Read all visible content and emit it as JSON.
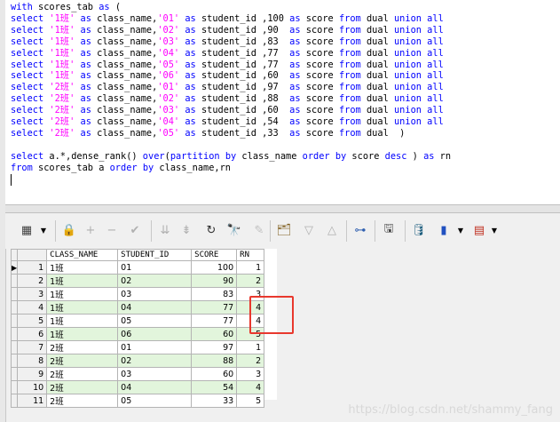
{
  "sql": {
    "lines": [
      [
        [
          "kw",
          "with"
        ],
        [
          "t",
          " scores_tab "
        ],
        [
          "kw",
          "as"
        ],
        [
          "t",
          " ("
        ]
      ],
      [
        [
          "kw",
          "select"
        ],
        [
          "t",
          " "
        ],
        [
          "str",
          "'1班'"
        ],
        [
          "t",
          " "
        ],
        [
          "kw",
          "as"
        ],
        [
          "t",
          " class_name,"
        ],
        [
          "str",
          "'01'"
        ],
        [
          "t",
          " "
        ],
        [
          "kw",
          "as"
        ],
        [
          "t",
          " student_id ,100 "
        ],
        [
          "kw",
          "as"
        ],
        [
          "t",
          " score "
        ],
        [
          "kw",
          "from"
        ],
        [
          "t",
          " dual "
        ],
        [
          "kw",
          "union"
        ],
        [
          "t",
          " "
        ],
        [
          "kw",
          "all"
        ]
      ],
      [
        [
          "kw",
          "select"
        ],
        [
          "t",
          " "
        ],
        [
          "str",
          "'1班'"
        ],
        [
          "t",
          " "
        ],
        [
          "kw",
          "as"
        ],
        [
          "t",
          " class_name,"
        ],
        [
          "str",
          "'02'"
        ],
        [
          "t",
          " "
        ],
        [
          "kw",
          "as"
        ],
        [
          "t",
          " student_id ,90  "
        ],
        [
          "kw",
          "as"
        ],
        [
          "t",
          " score "
        ],
        [
          "kw",
          "from"
        ],
        [
          "t",
          " dual "
        ],
        [
          "kw",
          "union"
        ],
        [
          "t",
          " "
        ],
        [
          "kw",
          "all"
        ]
      ],
      [
        [
          "kw",
          "select"
        ],
        [
          "t",
          " "
        ],
        [
          "str",
          "'1班'"
        ],
        [
          "t",
          " "
        ],
        [
          "kw",
          "as"
        ],
        [
          "t",
          " class_name,"
        ],
        [
          "str",
          "'03'"
        ],
        [
          "t",
          " "
        ],
        [
          "kw",
          "as"
        ],
        [
          "t",
          " student_id ,83  "
        ],
        [
          "kw",
          "as"
        ],
        [
          "t",
          " score "
        ],
        [
          "kw",
          "from"
        ],
        [
          "t",
          " dual "
        ],
        [
          "kw",
          "union"
        ],
        [
          "t",
          " "
        ],
        [
          "kw",
          "all"
        ]
      ],
      [
        [
          "kw",
          "select"
        ],
        [
          "t",
          " "
        ],
        [
          "str",
          "'1班'"
        ],
        [
          "t",
          " "
        ],
        [
          "kw",
          "as"
        ],
        [
          "t",
          " class_name,"
        ],
        [
          "str",
          "'04'"
        ],
        [
          "t",
          " "
        ],
        [
          "kw",
          "as"
        ],
        [
          "t",
          " student_id ,77  "
        ],
        [
          "kw",
          "as"
        ],
        [
          "t",
          " score "
        ],
        [
          "kw",
          "from"
        ],
        [
          "t",
          " dual "
        ],
        [
          "kw",
          "union"
        ],
        [
          "t",
          " "
        ],
        [
          "kw",
          "all"
        ]
      ],
      [
        [
          "kw",
          "select"
        ],
        [
          "t",
          " "
        ],
        [
          "str",
          "'1班'"
        ],
        [
          "t",
          " "
        ],
        [
          "kw",
          "as"
        ],
        [
          "t",
          " class_name,"
        ],
        [
          "str",
          "'05'"
        ],
        [
          "t",
          " "
        ],
        [
          "kw",
          "as"
        ],
        [
          "t",
          " student_id ,77  "
        ],
        [
          "kw",
          "as"
        ],
        [
          "t",
          " score "
        ],
        [
          "kw",
          "from"
        ],
        [
          "t",
          " dual "
        ],
        [
          "kw",
          "union"
        ],
        [
          "t",
          " "
        ],
        [
          "kw",
          "all"
        ]
      ],
      [
        [
          "kw",
          "select"
        ],
        [
          "t",
          " "
        ],
        [
          "str",
          "'1班'"
        ],
        [
          "t",
          " "
        ],
        [
          "kw",
          "as"
        ],
        [
          "t",
          " class_name,"
        ],
        [
          "str",
          "'06'"
        ],
        [
          "t",
          " "
        ],
        [
          "kw",
          "as"
        ],
        [
          "t",
          " student_id ,60  "
        ],
        [
          "kw",
          "as"
        ],
        [
          "t",
          " score "
        ],
        [
          "kw",
          "from"
        ],
        [
          "t",
          " dual "
        ],
        [
          "kw",
          "union"
        ],
        [
          "t",
          " "
        ],
        [
          "kw",
          "all"
        ]
      ],
      [
        [
          "kw",
          "select"
        ],
        [
          "t",
          " "
        ],
        [
          "str",
          "'2班'"
        ],
        [
          "t",
          " "
        ],
        [
          "kw",
          "as"
        ],
        [
          "t",
          " class_name,"
        ],
        [
          "str",
          "'01'"
        ],
        [
          "t",
          " "
        ],
        [
          "kw",
          "as"
        ],
        [
          "t",
          " student_id ,97  "
        ],
        [
          "kw",
          "as"
        ],
        [
          "t",
          " score "
        ],
        [
          "kw",
          "from"
        ],
        [
          "t",
          " dual "
        ],
        [
          "kw",
          "union"
        ],
        [
          "t",
          " "
        ],
        [
          "kw",
          "all"
        ]
      ],
      [
        [
          "kw",
          "select"
        ],
        [
          "t",
          " "
        ],
        [
          "str",
          "'2班'"
        ],
        [
          "t",
          " "
        ],
        [
          "kw",
          "as"
        ],
        [
          "t",
          " class_name,"
        ],
        [
          "str",
          "'02'"
        ],
        [
          "t",
          " "
        ],
        [
          "kw",
          "as"
        ],
        [
          "t",
          " student_id ,88  "
        ],
        [
          "kw",
          "as"
        ],
        [
          "t",
          " score "
        ],
        [
          "kw",
          "from"
        ],
        [
          "t",
          " dual "
        ],
        [
          "kw",
          "union"
        ],
        [
          "t",
          " "
        ],
        [
          "kw",
          "all"
        ]
      ],
      [
        [
          "kw",
          "select"
        ],
        [
          "t",
          " "
        ],
        [
          "str",
          "'2班'"
        ],
        [
          "t",
          " "
        ],
        [
          "kw",
          "as"
        ],
        [
          "t",
          " class_name,"
        ],
        [
          "str",
          "'03'"
        ],
        [
          "t",
          " "
        ],
        [
          "kw",
          "as"
        ],
        [
          "t",
          " student_id ,60  "
        ],
        [
          "kw",
          "as"
        ],
        [
          "t",
          " score "
        ],
        [
          "kw",
          "from"
        ],
        [
          "t",
          " dual "
        ],
        [
          "kw",
          "union"
        ],
        [
          "t",
          " "
        ],
        [
          "kw",
          "all"
        ]
      ],
      [
        [
          "kw",
          "select"
        ],
        [
          "t",
          " "
        ],
        [
          "str",
          "'2班'"
        ],
        [
          "t",
          " "
        ],
        [
          "kw",
          "as"
        ],
        [
          "t",
          " class_name,"
        ],
        [
          "str",
          "'04'"
        ],
        [
          "t",
          " "
        ],
        [
          "kw",
          "as"
        ],
        [
          "t",
          " student_id ,54  "
        ],
        [
          "kw",
          "as"
        ],
        [
          "t",
          " score "
        ],
        [
          "kw",
          "from"
        ],
        [
          "t",
          " dual "
        ],
        [
          "kw",
          "union"
        ],
        [
          "t",
          " "
        ],
        [
          "kw",
          "all"
        ]
      ],
      [
        [
          "kw",
          "select"
        ],
        [
          "t",
          " "
        ],
        [
          "str",
          "'2班'"
        ],
        [
          "t",
          " "
        ],
        [
          "kw",
          "as"
        ],
        [
          "t",
          " class_name,"
        ],
        [
          "str",
          "'05'"
        ],
        [
          "t",
          " "
        ],
        [
          "kw",
          "as"
        ],
        [
          "t",
          " student_id ,33  "
        ],
        [
          "kw",
          "as"
        ],
        [
          "t",
          " score "
        ],
        [
          "kw",
          "from"
        ],
        [
          "t",
          " dual  )"
        ]
      ],
      [],
      [
        [
          "kw",
          "select"
        ],
        [
          "t",
          " a.*,dense_rank() "
        ],
        [
          "kw",
          "over"
        ],
        [
          "t",
          "("
        ],
        [
          "kw",
          "partition"
        ],
        [
          "t",
          " "
        ],
        [
          "kw",
          "by"
        ],
        [
          "t",
          " class_name "
        ],
        [
          "kw",
          "order"
        ],
        [
          "t",
          " "
        ],
        [
          "kw",
          "by"
        ],
        [
          "t",
          " score "
        ],
        [
          "kw",
          "desc"
        ],
        [
          "t",
          " ) "
        ],
        [
          "kw",
          "as"
        ],
        [
          "t",
          " rn"
        ]
      ],
      [
        [
          "kw",
          "from"
        ],
        [
          "t",
          " scores_tab a "
        ],
        [
          "kw",
          "order"
        ],
        [
          "t",
          " "
        ],
        [
          "kw",
          "by"
        ],
        [
          "t",
          " class_name,rn"
        ]
      ]
    ]
  },
  "toolbar": {
    "buttons": [
      {
        "name": "grid-view-icon",
        "glyph": "▦",
        "color": "#404040",
        "clickable": true
      },
      {
        "name": "lock-icon",
        "glyph": "🔒",
        "color": "#505050",
        "clickable": true
      },
      {
        "name": "add-record-icon",
        "glyph": "+",
        "color": "#b0b0b0",
        "clickable": false
      },
      {
        "name": "delete-record-icon",
        "glyph": "−",
        "color": "#b0b0b0",
        "clickable": false
      },
      {
        "name": "post-changes-icon",
        "glyph": "✔",
        "color": "#b0b0b0",
        "clickable": false
      },
      {
        "name": "next-record-icon",
        "glyph": "⇊",
        "color": "#b0b0b0",
        "clickable": false
      },
      {
        "name": "last-record-icon",
        "glyph": "⇟",
        "color": "#b0b0b0",
        "clickable": false
      },
      {
        "name": "refresh-icon",
        "glyph": "↻",
        "color": "#303030",
        "clickable": true
      },
      {
        "name": "find-icon",
        "glyph": "🔭",
        "color": "#303030",
        "clickable": true
      },
      {
        "name": "clear-filter-icon",
        "glyph": "✎",
        "color": "#c0c0c0",
        "clickable": false
      },
      {
        "name": "query-by-example-icon",
        "glyph": "🗂",
        "color": "#806020",
        "clickable": true
      },
      {
        "name": "sort-down-icon",
        "glyph": "▽",
        "color": "#b0b0b0",
        "clickable": false
      },
      {
        "name": "sort-up-icon",
        "glyph": "△",
        "color": "#b0b0b0",
        "clickable": false
      },
      {
        "name": "tree-view-icon",
        "glyph": "⊶",
        "color": "#3060b0",
        "clickable": true
      },
      {
        "name": "save-icon",
        "glyph": "🖫",
        "color": "#404040",
        "clickable": true
      },
      {
        "name": "export-icon",
        "glyph": "🛢",
        "color": "#206080",
        "clickable": true
      },
      {
        "name": "chart-icon",
        "glyph": "▮",
        "color": "#2050c0",
        "clickable": true
      },
      {
        "name": "table-icon",
        "glyph": "▤",
        "color": "#c03020",
        "clickable": true
      }
    ]
  },
  "grid": {
    "columns": [
      "CLASS_NAME",
      "STUDENT_ID",
      "SCORE",
      "RN"
    ],
    "rows": [
      {
        "n": "1",
        "class": "1班",
        "sid": "01",
        "score": "100",
        "rn": "1"
      },
      {
        "n": "2",
        "class": "1班",
        "sid": "02",
        "score": "90",
        "rn": "2"
      },
      {
        "n": "3",
        "class": "1班",
        "sid": "03",
        "score": "83",
        "rn": "3"
      },
      {
        "n": "4",
        "class": "1班",
        "sid": "04",
        "score": "77",
        "rn": "4"
      },
      {
        "n": "5",
        "class": "1班",
        "sid": "05",
        "score": "77",
        "rn": "4"
      },
      {
        "n": "6",
        "class": "1班",
        "sid": "06",
        "score": "60",
        "rn": "5"
      },
      {
        "n": "7",
        "class": "2班",
        "sid": "01",
        "score": "97",
        "rn": "1"
      },
      {
        "n": "8",
        "class": "2班",
        "sid": "02",
        "score": "88",
        "rn": "2"
      },
      {
        "n": "9",
        "class": "2班",
        "sid": "03",
        "score": "60",
        "rn": "3"
      },
      {
        "n": "10",
        "class": "2班",
        "sid": "04",
        "score": "54",
        "rn": "4"
      },
      {
        "n": "11",
        "class": "2班",
        "sid": "05",
        "score": "33",
        "rn": "5"
      }
    ]
  },
  "watermark": "https://blog.csdn.net/shammy_fang",
  "colors": {
    "keyword": "#0000ff",
    "string": "#ff00ff",
    "alt_row": "#e2f5dc",
    "highlight": "#e8382d"
  }
}
